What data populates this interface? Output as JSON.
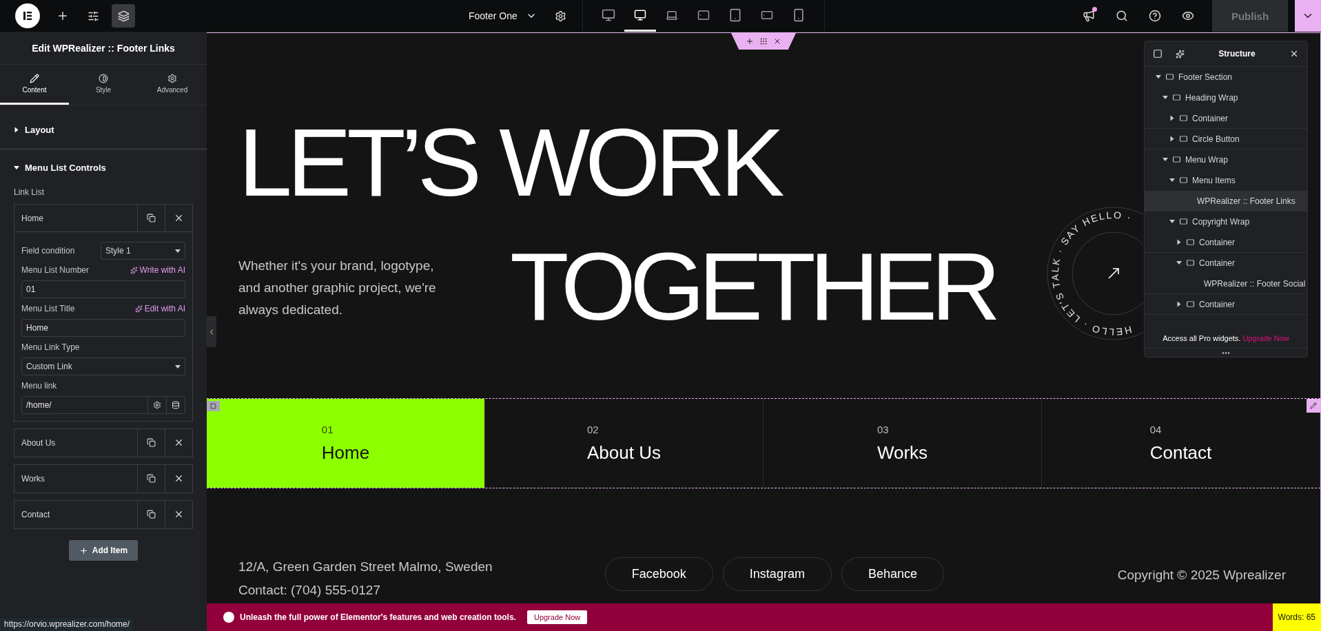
{
  "topbar": {
    "tools": [
      {
        "kind": "add",
        "selected": false
      },
      {
        "kind": "settings",
        "selected": false
      },
      {
        "kind": "structure",
        "selected": true
      }
    ],
    "document": {
      "title": "Footer One"
    },
    "devices": [
      {
        "kind": "widescreen",
        "selected": false
      },
      {
        "kind": "desktop",
        "selected": true
      },
      {
        "kind": "laptop",
        "selected": false
      },
      {
        "kind": "tablet_extra",
        "selected": false
      },
      {
        "kind": "tablet",
        "selected": false
      },
      {
        "kind": "mobile_extra",
        "selected": false
      },
      {
        "kind": "mobile",
        "selected": false
      }
    ],
    "notifications_unread": true,
    "publish": {
      "label": "Publish",
      "disabled": true
    }
  },
  "panel": {
    "title": "Edit WPRealizer :: Footer Links",
    "tabs": [
      {
        "kind": "pencil",
        "label": "Content",
        "selected": true
      },
      {
        "kind": "contrast",
        "label": "Style",
        "selected": false
      },
      {
        "kind": "gear",
        "label": "Advanced",
        "selected": false
      }
    ],
    "sections": [
      {
        "title": "Layout",
        "expanded": false
      },
      {
        "title": "Menu List Controls",
        "expanded": true
      }
    ],
    "repeater": {
      "label": "Link List",
      "items": [
        {
          "title": "Home",
          "expanded": true,
          "fields": [
            {
              "kind": "inline_select",
              "label": "Field condition",
              "value": "Style 1"
            },
            {
              "kind": "text",
              "label": "Menu List Number",
              "ai_action": "Write with AI",
              "value": "01"
            },
            {
              "kind": "text",
              "label": "Menu List Title",
              "ai_action": "Edit with AI",
              "value": "Home"
            },
            {
              "kind": "select",
              "label": "Menu Link Type",
              "value": "Custom Link"
            },
            {
              "kind": "link",
              "label": "Menu link",
              "value": "/home/"
            }
          ]
        },
        {
          "title": "About Us",
          "expanded": false
        },
        {
          "title": "Works",
          "expanded": false
        },
        {
          "title": "Contact",
          "expanded": false
        }
      ],
      "add_button": "Add Item"
    },
    "status_url": "https://orvio.wprealizer.com/home/"
  },
  "canvas": {
    "heading_line_1": "LET’S WORK",
    "heading_line_2": "TOGETHER",
    "intro": "Whether it's your brand, logotype, and another graphic project, we're always dedicated.",
    "badge_ring": "HELLO · LET'S TALK · SAY HELLO ·",
    "menu": [
      {
        "number": "01",
        "title": "Home",
        "selected": true
      },
      {
        "number": "02",
        "title": "About Us",
        "selected": false
      },
      {
        "number": "03",
        "title": "Works",
        "selected": false
      },
      {
        "number": "04",
        "title": "Contact",
        "selected": false
      }
    ],
    "address": "12/A, Green Garden Street Malmo, Sweden",
    "contact": "Contact: (704) 555-0127",
    "socials": [
      "Facebook",
      "Instagram",
      "Behance"
    ],
    "copyright": "Copyright © 2025 Wprealizer"
  },
  "structure": {
    "title": "Structure",
    "tree": [
      {
        "label": "Footer Section",
        "kind": "container",
        "expanded": true,
        "selected": false,
        "children": [
          {
            "label": "Heading Wrap",
            "kind": "container",
            "expanded": true,
            "selected": false,
            "children": [
              {
                "label": "Container",
                "kind": "container",
                "expanded": false,
                "selected": false
              },
              {
                "label": "Circle Button",
                "kind": "container",
                "expanded": false,
                "selected": false
              }
            ]
          },
          {
            "label": "Menu Wrap",
            "kind": "container",
            "expanded": true,
            "selected": false,
            "children": [
              {
                "label": "Menu Items",
                "kind": "container",
                "expanded": true,
                "selected": false,
                "children": [
                  {
                    "label": "WPRealizer :: Footer Links",
                    "kind": "widget",
                    "selected": true
                  }
                ]
              },
              {
                "label": "Copyright Wrap",
                "kind": "container",
                "expanded": true,
                "selected": false,
                "children": [
                  {
                    "label": "Container",
                    "kind": "container",
                    "expanded": false,
                    "selected": false
                  },
                  {
                    "label": "Container",
                    "kind": "container",
                    "expanded": true,
                    "selected": false,
                    "children": [
                      {
                        "label": "WPRealizer :: Footer Social",
                        "kind": "widget",
                        "selected": false
                      }
                    ]
                  },
                  {
                    "label": "Container",
                    "kind": "container",
                    "expanded": false,
                    "selected": false
                  }
                ]
              }
            ]
          }
        ]
      }
    ],
    "promo": "Access all Pro widgets.",
    "promo_link": "Upgrade Now"
  },
  "promo_bar": {
    "text": "Unleash the full power of Elementor's features and web creation tools.",
    "button": "Upgrade Now"
  },
  "word_count": "Words: 65"
}
